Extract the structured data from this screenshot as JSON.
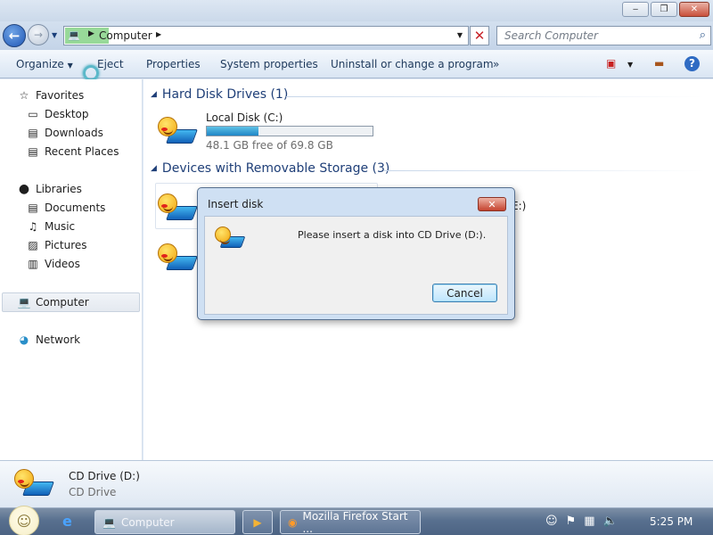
{
  "window": {
    "minimize_glyph": "‒",
    "maximize_glyph": "❐",
    "close_glyph": "✕"
  },
  "address_bar": {
    "location": "Computer",
    "search_placeholder": "Search Computer"
  },
  "command_bar": {
    "organize": "Organize",
    "eject": "Eject",
    "properties": "Properties",
    "system_properties": "System properties",
    "uninstall": "Uninstall or change a program",
    "more": "»"
  },
  "nav": {
    "favorites": "Favorites",
    "desktop": "Desktop",
    "downloads": "Downloads",
    "recent_places": "Recent Places",
    "libraries": "Libraries",
    "documents": "Documents",
    "music": "Music",
    "pictures": "Pictures",
    "videos": "Videos",
    "computer": "Computer",
    "network": "Network"
  },
  "content": {
    "hard_disk_group": "Hard Disk Drives (1)",
    "local_disk_name": "Local Disk (C:)",
    "local_disk_free": "48.1 GB free of 69.8 GB",
    "local_disk_used_fraction": 0.31,
    "removable_group": "Devices with Removable Storage (3)",
    "partial_label": "E:)"
  },
  "details": {
    "name": "CD Drive (D:)",
    "type": "CD Drive"
  },
  "dialog": {
    "title": "Insert disk",
    "message": "Please insert a disk into CD Drive (D:).",
    "cancel": "Cancel"
  },
  "taskbar": {
    "computer": "Computer",
    "firefox": "Mozilla Firefox Start ...",
    "clock": "5:25 PM"
  },
  "colors": {
    "accent": "#1f3f78",
    "selection": "#7ed07f",
    "bar_fill": "#1f86c6"
  }
}
